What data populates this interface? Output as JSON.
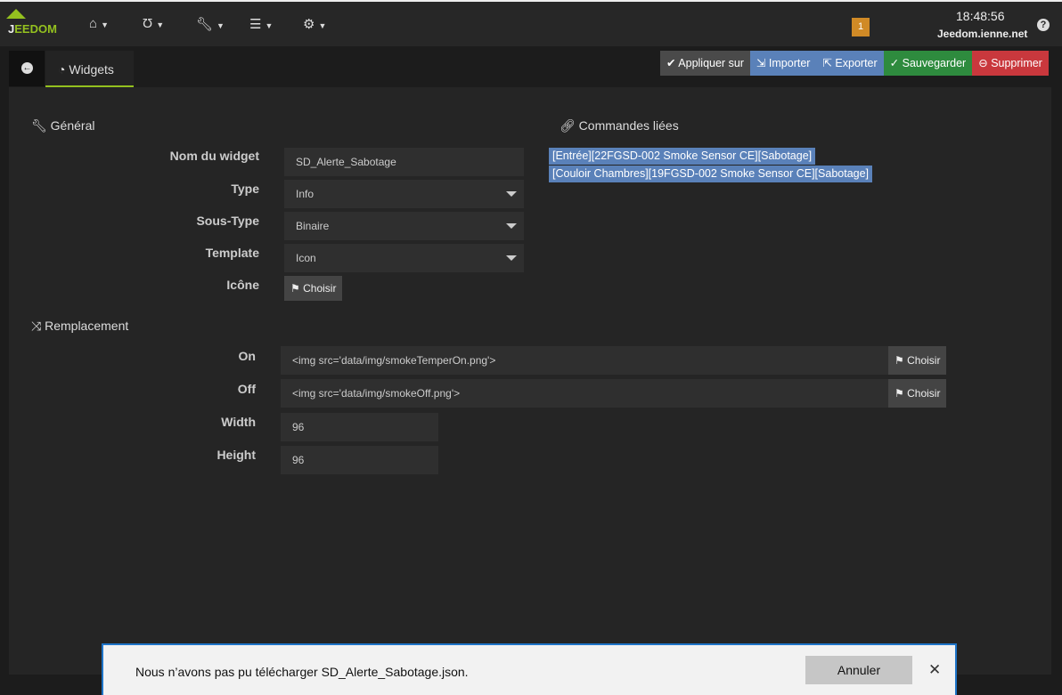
{
  "nav": {
    "logo": "JEEDOM",
    "menus": [
      {
        "icon": "home-icon",
        "glyph": "⌂"
      },
      {
        "icon": "stethoscope-icon",
        "glyph": "Ʊ"
      },
      {
        "icon": "wrench-icon",
        "glyph": "🔧"
      },
      {
        "icon": "list-icon",
        "glyph": "☰"
      },
      {
        "icon": "gear-icon",
        "glyph": "⚙"
      }
    ],
    "badge": "1",
    "clock": "18:48:56",
    "host": "Jeedom.ienne.net"
  },
  "tab": {
    "label": "Widgets"
  },
  "actions": [
    {
      "label": "Appliquer sur",
      "glyph": "✔",
      "color": "#4a4a4a"
    },
    {
      "label": "Importer",
      "glyph": "⇲",
      "color": "#5a81b9"
    },
    {
      "label": "Exporter",
      "glyph": "⇱",
      "color": "#5a81b9"
    },
    {
      "label": "Sauvegarder",
      "glyph": "✓",
      "color": "#2e8b3e"
    },
    {
      "label": "Supprimer",
      "glyph": "⊖",
      "color": "#c9383d"
    }
  ],
  "general": {
    "title": "Général",
    "fields": {
      "name_label": "Nom du widget",
      "name_value": "SD_Alerte_Sabotage",
      "type_label": "Type",
      "type_value": "Info",
      "subtype_label": "Sous-Type",
      "subtype_value": "Binaire",
      "template_label": "Template",
      "template_value": "Icon",
      "icon_label": "Icône",
      "choose": "Choisir"
    }
  },
  "linked": {
    "title": "Commandes liées",
    "items": [
      "[Entrée][22FGSD-002 Smoke Sensor CE][Sabotage]",
      "[Couloir Chambres][19FGSD-002 Smoke Sensor CE][Sabotage]"
    ]
  },
  "replace": {
    "title": "Remplacement",
    "on_label": "On",
    "on_value": "<img src='data/img/smokeTemperOn.png'>",
    "off_label": "Off",
    "off_value": "<img src='data/img/smokeOff.png'>",
    "width_label": "Width",
    "width_value": "96",
    "height_label": "Height",
    "height_value": "96",
    "choose": "Choisir"
  },
  "download": {
    "message": "Nous n’avons pas pu télécharger SD_Alerte_Sabotage.json.",
    "cancel": "Annuler",
    "close": "✕"
  }
}
